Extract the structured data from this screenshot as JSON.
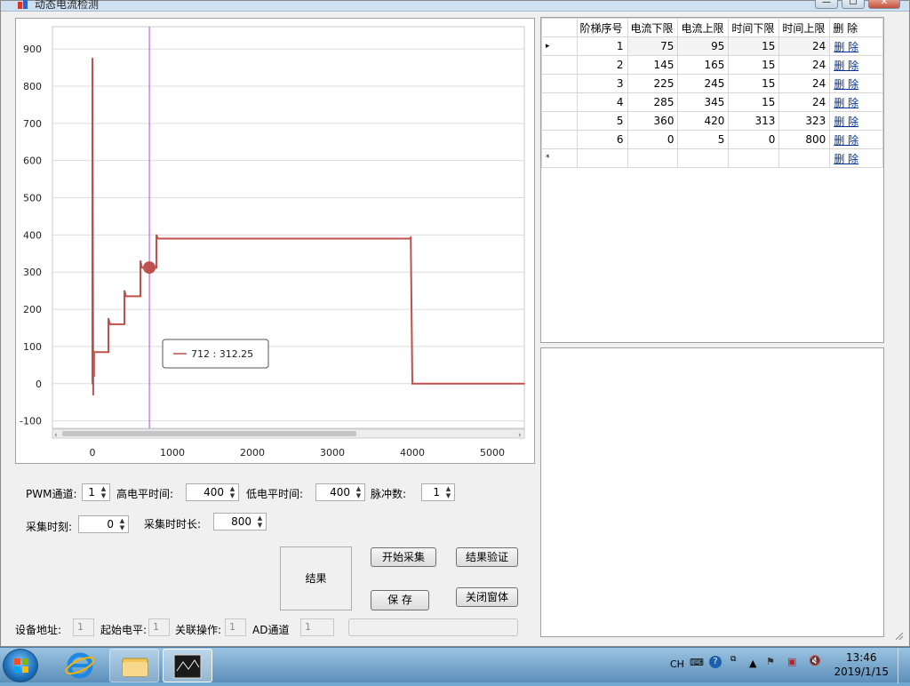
{
  "window": {
    "title": "动态电流检测",
    "minimize": "—",
    "maximize": "☐",
    "close": "✕"
  },
  "chart_data": {
    "type": "line",
    "title": "",
    "xlabel": "",
    "ylabel": "",
    "xlim": [
      -500,
      5400
    ],
    "ylim": [
      -120,
      960
    ],
    "x_ticks": [
      "0",
      "1000",
      "2000",
      "3000",
      "4000",
      "5000"
    ],
    "y_ticks": [
      "-100",
      "0",
      "100",
      "200",
      "300",
      "400",
      "500",
      "600",
      "700",
      "800",
      "900"
    ],
    "grid": true,
    "series": [
      {
        "color": "#c0504d",
        "x": [
          0,
          0,
          10,
          10,
          20,
          20,
          200,
          200,
          220,
          220,
          400,
          400,
          420,
          420,
          600,
          600,
          620,
          620,
          800,
          800,
          820,
          820,
          3980,
          3980,
          4000,
          5400
        ],
        "y": [
          0,
          875,
          -30,
          90,
          20,
          85,
          85,
          175,
          160,
          160,
          160,
          250,
          235,
          235,
          235,
          330,
          312,
          312,
          312,
          400,
          390,
          390,
          390,
          395,
          0,
          0
        ]
      }
    ],
    "cursor": {
      "x": 712,
      "y": 312.25
    },
    "tooltip": "712 : 312.25"
  },
  "grid": {
    "columns": [
      "阶梯序号",
      "电流下限",
      "电流上限",
      "时间下限",
      "时间上限",
      "删 除"
    ],
    "rows": [
      {
        "marker": "▸",
        "values": [
          "1",
          "75",
          "95",
          "15",
          "24"
        ],
        "action": "删 除"
      },
      {
        "marker": "",
        "values": [
          "2",
          "145",
          "165",
          "15",
          "24"
        ],
        "action": "删 除"
      },
      {
        "marker": "",
        "values": [
          "3",
          "225",
          "245",
          "15",
          "24"
        ],
        "action": "删 除"
      },
      {
        "marker": "",
        "values": [
          "4",
          "285",
          "345",
          "15",
          "24"
        ],
        "action": "删 除"
      },
      {
        "marker": "",
        "values": [
          "5",
          "360",
          "420",
          "313",
          "323"
        ],
        "action": "删 除"
      },
      {
        "marker": "",
        "values": [
          "6",
          "0",
          "5",
          "0",
          "800"
        ],
        "action": "删 除"
      },
      {
        "marker": "*",
        "values": [
          "",
          "",
          "",
          "",
          ""
        ],
        "action": "删 除"
      }
    ]
  },
  "controls": {
    "pwm_label": "PWM通道:",
    "pwm_value": "1",
    "high_label": "高电平时间:",
    "high_value": "400",
    "low_label": "低电平时间:",
    "low_value": "400",
    "pulse_label": "脉冲数:",
    "pulse_value": "1",
    "sample_time_label": "采集时刻:",
    "sample_time_value": "0",
    "sample_dur_label": "采集时时长:",
    "sample_dur_value": "800",
    "result_button": "结果",
    "start_button": "开始采集",
    "verify_button": "结果验证",
    "save_button": "保 存",
    "close_button": "关闭窗体",
    "device_label": "设备地址:",
    "device_value": "1",
    "start_level_label": "起始电平:",
    "start_level_value": "1",
    "link_label": "关联操作:",
    "link_value": "1",
    "ad_label": "AD通道",
    "ad_value": "1"
  },
  "taskbar": {
    "lang": "CH",
    "time": "13:46",
    "date": "2019/1/15"
  }
}
